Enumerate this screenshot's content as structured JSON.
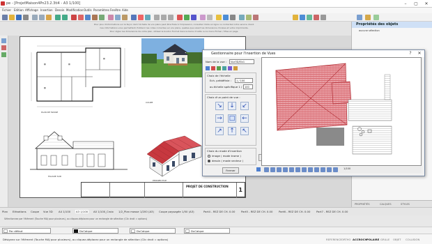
{
  "window": {
    "title": "pe - [ProjetMaison4Pn23.2.3ti4 - A3 1/100]"
  },
  "menu": [
    "Fichier",
    "Edition",
    "Affichage",
    "Insertion",
    "Dessin",
    "Modification",
    "Outils",
    "Paramètres",
    "Fenêtre",
    "Aide"
  ],
  "info_bar": {
    "line1": "Pour plus d'informations sur la façon dont l'échelle de vos plans peut être fixée à l'impression, consultez l'Aide en ligne ou contactez notre service client.",
    "line2": "Ces informations vous permettent d'obtenir les cotes correctes sur vos plans, quelles que soient les dimensions choisies et votre imprimante.",
    "line3": "Pour régler les dimensions de votre plan, utilisez le bouton Format dans la barre d'outils ou le menu Fichier / Mise en page."
  },
  "sheet": {
    "label_plan": "PLAN DE MASSE",
    "label_coupe": "COUPE",
    "label_facade1": "FACADE SUD",
    "label_facade2": "PERSPECTIVE",
    "cartouche_title": "PROJET DE CONSTRUCTION",
    "cartouche_page": "1"
  },
  "right_panel": {
    "title": "Propriétés des objets",
    "selection": "aucune sélection",
    "tabs": [
      "PROPRIÉTÉS",
      "CALQUES",
      "STYLES"
    ]
  },
  "dialog": {
    "title": "Gestionnaire pour l'insertion de Vues",
    "view_name_label": "Nom de la vue :",
    "view_name_value": "Vue3D/Elv1",
    "scale_group_label": "Choix de l'échelle",
    "predefined_label": "Ech. prédéfinie :",
    "predefined_value": "1 / 100",
    "specific_label": "ou échelle spécifique 1 /",
    "specific_value": "100",
    "viewpoint_label": "Choix d'un point de vue :",
    "mode_group_label": "Choix du mode d'insertion",
    "mode_image": "image ( mode trame )",
    "mode_vector": "dessin ( mode vecteur )",
    "insert_button": "Insérer",
    "close_button": "Fermer",
    "zoom_value": "1/100"
  },
  "layout_tabs": [
    "Plan",
    "Elévations",
    "Coupe",
    "Vue 3D",
    "A4 1/100",
    "A3 1/100",
    "A0 1/100_Croix",
    "1/2_Plan masse 1/200 (A3)",
    "Coupe paysagée 1/50 (A3)",
    "Part4 - REZ DE CH. 0.00",
    "Part5 - REZ DE CH. 0.00",
    "Part6 - REZ DE CH. 0.00",
    "Part7 - REZ DE CH. 0.00"
  ],
  "hint": {
    "line1": "Sélectionnez par l'élément (Touche MAJ pour plusieurs), ou cliquez-déplacez pour un rectangle de sélection (Clic droit = options)",
    "line2": ""
  },
  "bottom_bar": {
    "style_combo": "Par défaut",
    "combo2": "DuCalque",
    "combo3": "DuCalque",
    "combo4": "DuCalque"
  },
  "status": {
    "message": "Désignez sur l'élément (Touche MAJ pour plusieurs), ou cliquez-déplacez pour un rectangle de sélection (Clic droit = options)",
    "modes": [
      "REFERENCE",
      "ORTHO",
      "ACCROCH",
      "POLAIRE",
      "GRILLE",
      "OBJET",
      "COLLISION"
    ],
    "active_modes": [
      "ACCROCH",
      "POLAIRE"
    ]
  },
  "colors": {
    "roof_red": "#c7383f",
    "roof_pink": "#e08a90",
    "panel_header": "#cfe0f6",
    "arrow_blue": "#2b4fb3"
  }
}
